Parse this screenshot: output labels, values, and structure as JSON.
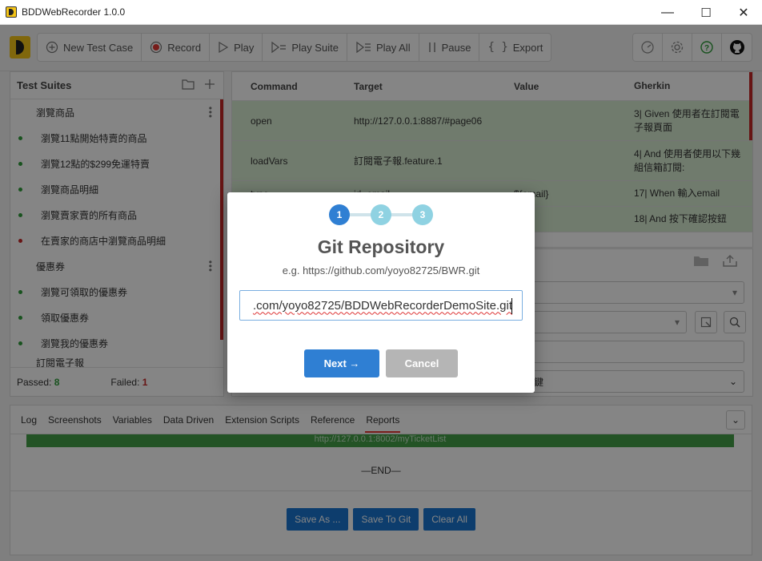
{
  "window": {
    "title": "BDDWebRecorder 1.0.0",
    "minimize": "—",
    "maximize": "☐",
    "close": "✕"
  },
  "toolbar": {
    "buttons": [
      {
        "label": "New Test Case",
        "icon": "plus-circle-icon"
      },
      {
        "label": "Record",
        "icon": "record-icon"
      },
      {
        "label": "Play",
        "icon": "play-icon"
      },
      {
        "label": "Play Suite",
        "icon": "play-suite-icon"
      },
      {
        "label": "Play All",
        "icon": "play-all-icon"
      },
      {
        "label": "Pause",
        "icon": "pause-icon"
      },
      {
        "label": "Export",
        "icon": "braces-icon"
      }
    ],
    "right_icons": [
      "speedometer-icon",
      "gear-icon",
      "help-icon",
      "github-icon"
    ]
  },
  "test_suites": {
    "title": "Test Suites",
    "items": [
      {
        "label": "瀏覽商品",
        "type": "group"
      },
      {
        "label": "瀏覽11點開始特賣的商品",
        "status": "passed"
      },
      {
        "label": "瀏覽12點的$299免運特賣",
        "status": "passed"
      },
      {
        "label": "瀏覽商品明細",
        "status": "passed"
      },
      {
        "label": "瀏覽賣家賣的所有商品",
        "status": "passed"
      },
      {
        "label": "在賣家的商店中瀏覽商品明細",
        "status": "failed"
      },
      {
        "label": "優惠券",
        "type": "group"
      },
      {
        "label": "瀏覽可領取的優惠券",
        "status": "passed"
      },
      {
        "label": "領取優惠券",
        "status": "passed"
      },
      {
        "label": "瀏覽我的優惠券",
        "status": "passed"
      },
      {
        "label": "訂閱電子報",
        "type": "group"
      }
    ],
    "passed_label": "Passed:",
    "passed": "8",
    "failed_label": "Failed:",
    "failed": "1"
  },
  "command_table": {
    "headers": [
      "Command",
      "Target",
      "Value",
      "Gherkin"
    ],
    "rows": [
      {
        "command": "open",
        "target": "http://127.0.0.1:8887/#page06",
        "value": "",
        "gherkin": "3| Given 使用者在訂閱電子報頁面"
      },
      {
        "command": "loadVars",
        "target": "訂閱電子報.feature.1",
        "value": "",
        "gherkin": "4| And 使用者使用以下幾組信箱訂閱:"
      },
      {
        "command": "type",
        "target": "id=email",
        "value": "${email}",
        "gherkin": "17| When 輸入email"
      },
      {
        "command": "",
        "target": "",
        "value": "",
        "gherkin": "18| And 按下確認按鈕"
      }
    ]
  },
  "detail": {
    "select_text": "鍵"
  },
  "bottom_tabs": {
    "tabs": [
      "Log",
      "Screenshots",
      "Variables",
      "Data Driven",
      "Extension Scripts",
      "Reference",
      "Reports"
    ],
    "active": "Reports",
    "report_url": "http://127.0.0.1:8002/myTicketList",
    "end_text": "—END—",
    "buttons": [
      "Save As ...",
      "Save To Git",
      "Clear All"
    ]
  },
  "modal": {
    "steps": [
      "1",
      "2",
      "3"
    ],
    "current_step": 1,
    "title": "Git Repository",
    "hint": "e.g. https://github.com/yoyo82725/BWR.git",
    "input_value": ".com/yoyo82725/BDDWebRecorderDemoSite.git",
    "next_label": "Next →",
    "cancel_label": "Cancel",
    "colors": {
      "step_active": "#2f7fd3",
      "step_inactive": "#8fd2e2",
      "next": "#2f7fd3",
      "cancel": "#b5b5b5"
    }
  }
}
